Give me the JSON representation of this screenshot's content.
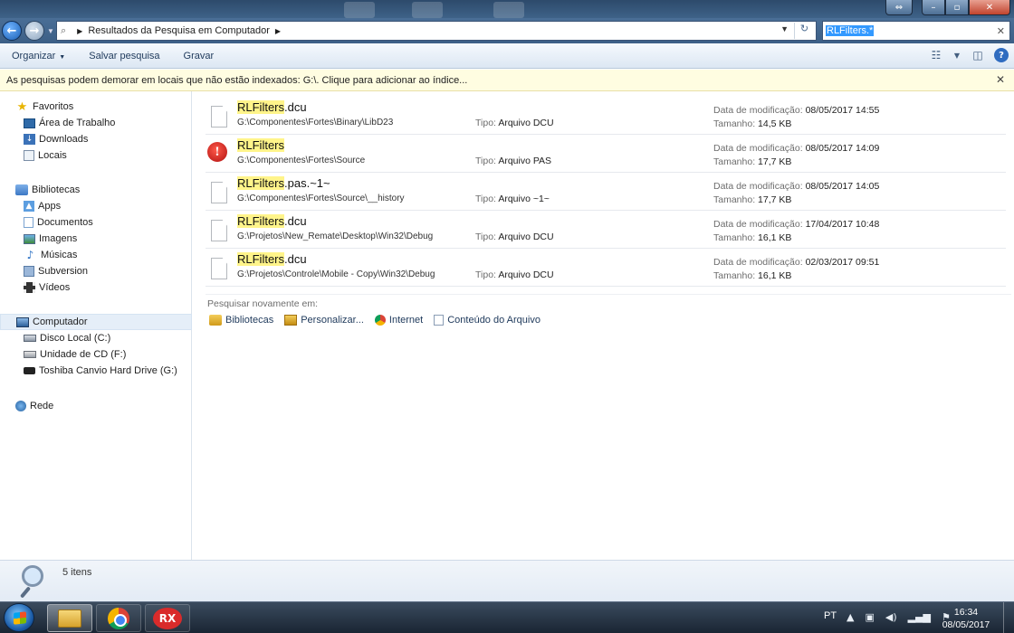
{
  "address": {
    "crumb": "Resultados da Pesquisa em Computador"
  },
  "search": {
    "query": "RLFilters.*"
  },
  "toolbar": {
    "organize": "Organizar",
    "save_search": "Salvar pesquisa",
    "burn": "Gravar"
  },
  "infobar": {
    "text": "As pesquisas podem demorar em locais que não estão indexados: G:\\. Clique para adicionar ao índice..."
  },
  "sidebar": {
    "favorites": "Favoritos",
    "favorites_items": [
      "Área de Trabalho",
      "Downloads",
      "Locais"
    ],
    "libraries": "Bibliotecas",
    "libraries_items": [
      "Apps",
      "Documentos",
      "Imagens",
      "Músicas",
      "Subversion",
      "Vídeos"
    ],
    "computer": "Computador",
    "computer_items": [
      "Disco Local (C:)",
      "Unidade de CD (F:)",
      "Toshiba Canvio Hard Drive (G:)"
    ],
    "network": "Rede"
  },
  "labels": {
    "type": "Tipo:",
    "modified": "Data de modificação:",
    "size": "Tamanho:"
  },
  "results": [
    {
      "highlight": "RLFilters",
      "rest": ".dcu",
      "path": "G:\\Componentes\\Fortes\\Binary\\LibD23",
      "type": "Arquivo DCU",
      "modified": "08/05/2017 14:55",
      "size": "14,5 KB"
    },
    {
      "highlight": "RLFilters",
      "rest": "",
      "path": "G:\\Componentes\\Fortes\\Source",
      "type": "Arquivo PAS",
      "modified": "08/05/2017 14:09",
      "size": "17,7 KB"
    },
    {
      "highlight": "RLFilters",
      "rest": ".pas.~1~",
      "path": "G:\\Componentes\\Fortes\\Source\\__history",
      "type": "Arquivo ~1~",
      "modified": "08/05/2017 14:05",
      "size": "17,7 KB"
    },
    {
      "highlight": "RLFilters",
      "rest": ".dcu",
      "path": "G:\\Projetos\\New_Remate\\Desktop\\Win32\\Debug",
      "type": "Arquivo DCU",
      "modified": "17/04/2017 10:48",
      "size": "16,1 KB"
    },
    {
      "highlight": "RLFilters",
      "rest": ".dcu",
      "path": "G:\\Projetos\\Controle\\Mobile - Copy\\Win32\\Debug",
      "type": "Arquivo DCU",
      "modified": "02/03/2017 09:51",
      "size": "16,1 KB"
    }
  ],
  "search_again": {
    "label": "Pesquisar novamente em:",
    "links": [
      "Bibliotecas",
      "Personalizar...",
      "Internet",
      "Conteúdo do Arquivo"
    ]
  },
  "status": {
    "count": "5 itens"
  },
  "taskbar": {
    "rx_label": "RX",
    "language": "PT",
    "time": "16:34",
    "date": "08/05/2017"
  }
}
